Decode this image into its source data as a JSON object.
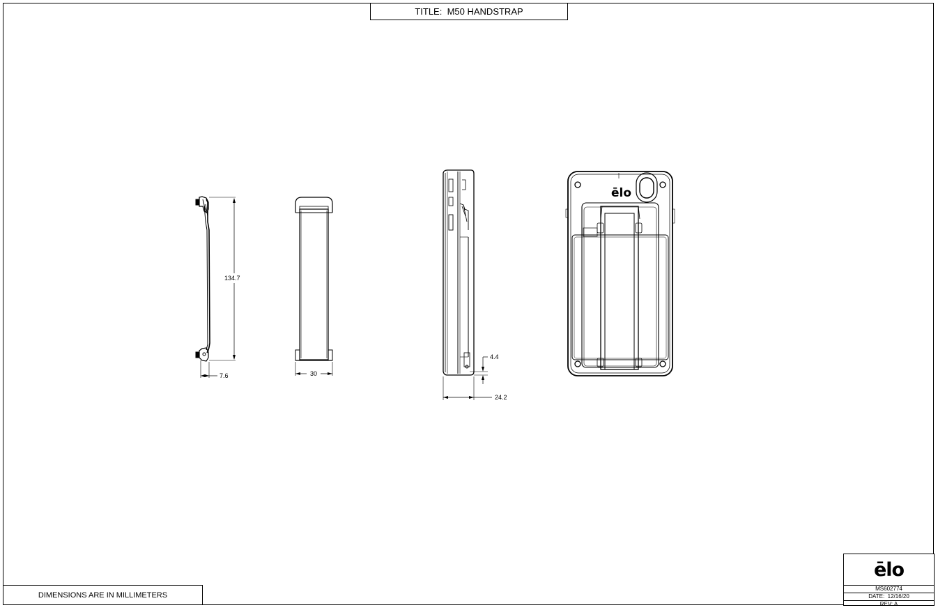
{
  "title_block": {
    "title_label": "TITLE:",
    "title_value": "M50 HANDSTRAP",
    "units_note": "DIMENSIONS ARE IN MILLIMETERS",
    "logo": "elo-logo",
    "part_number": "MS602774",
    "date_label": "DATE:",
    "date_value": "12/16/20",
    "rev_label": "REV:",
    "rev_value": "A"
  },
  "dimensions": {
    "strap_height": "134.7",
    "strap_depth": "7.6",
    "strap_width": "30",
    "device_offset": "4.4",
    "device_depth": "24.2"
  },
  "views": [
    "strap-side-view",
    "strap-front-view",
    "device-side-view",
    "device-back-view"
  ],
  "logo_text": "ēlo"
}
